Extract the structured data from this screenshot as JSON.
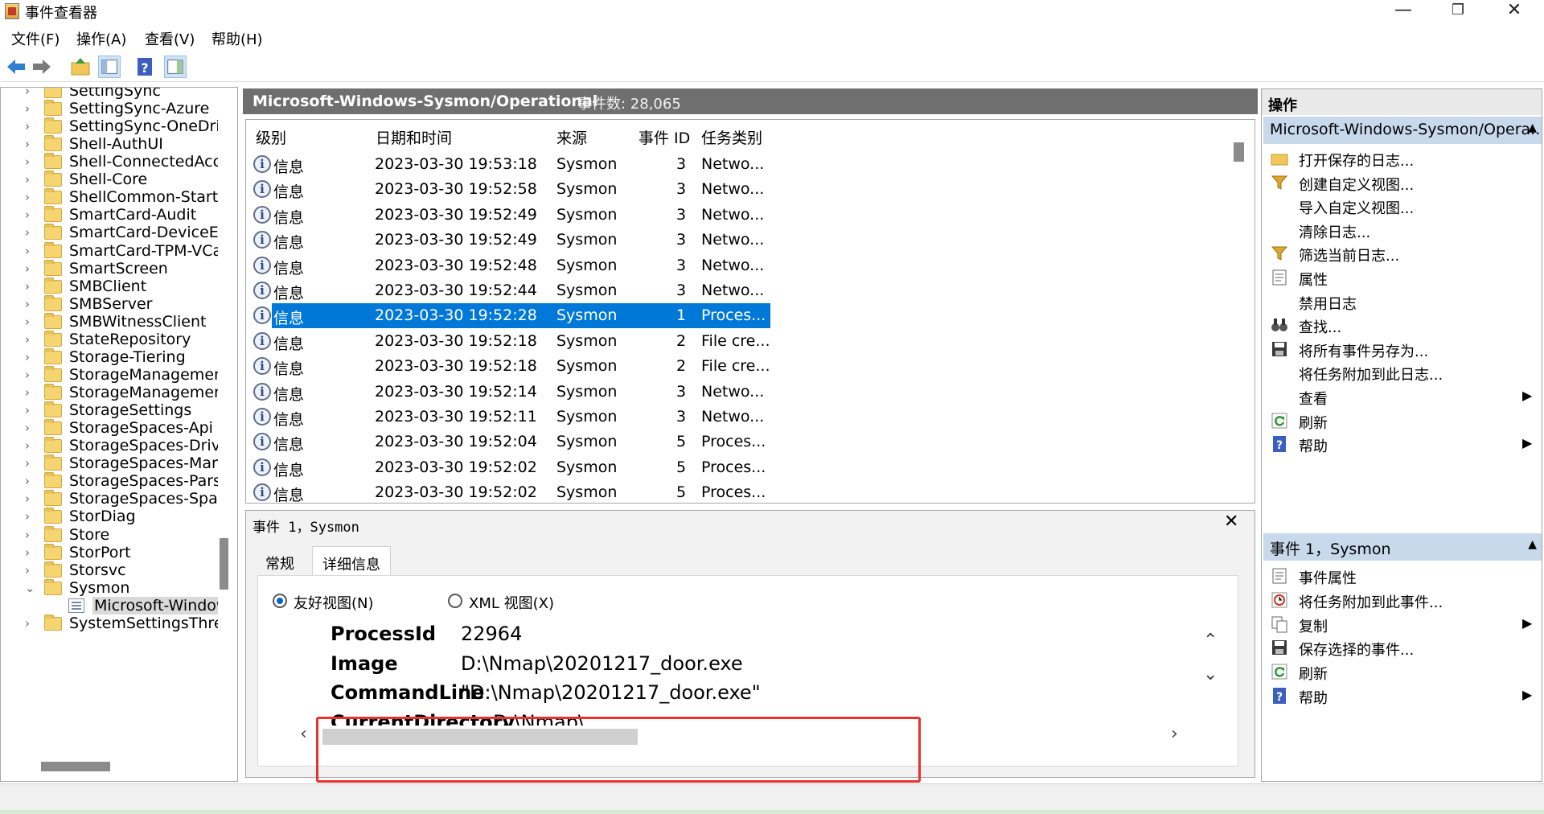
{
  "window": {
    "title": "事件查看器"
  },
  "menu": [
    "文件(F)",
    "操作(A)",
    "查看(V)",
    "帮助(H)"
  ],
  "tree": {
    "items": [
      "SettingSync",
      "SettingSync-Azure",
      "SettingSync-OneDrive",
      "Shell-AuthUI",
      "Shell-ConnectedAccou",
      "Shell-Core",
      "ShellCommon-StartLa",
      "SmartCard-Audit",
      "SmartCard-DeviceEnu",
      "SmartCard-TPM-VCard",
      "SmartScreen",
      "SMBClient",
      "SMBServer",
      "SMBWitnessClient",
      "StateRepository",
      "Storage-Tiering",
      "StorageManagement",
      "StorageManagement-",
      "StorageSettings",
      "StorageSpaces-Api",
      "StorageSpaces-Driver",
      "StorageSpaces-Manag",
      "StorageSpaces-Parser",
      "StorageSpaces-SpaceI",
      "StorDiag",
      "Store",
      "StorPort",
      "Storsvc",
      "Sysmon"
    ],
    "selected": "Microsoft-Window",
    "after": "SystemSettingsThresh"
  },
  "log": {
    "name": "Microsoft-Windows-Sysmon/Operational",
    "count": "事件数: 28,065"
  },
  "columns": [
    "级别",
    "日期和时间",
    "来源",
    "事件 ID",
    "任务类别"
  ],
  "events": [
    {
      "level": "信息",
      "time": "2023-03-30 19:53:18",
      "source": "Sysmon",
      "id": "3",
      "task": "Netwo..."
    },
    {
      "level": "信息",
      "time": "2023-03-30 19:52:58",
      "source": "Sysmon",
      "id": "3",
      "task": "Netwo..."
    },
    {
      "level": "信息",
      "time": "2023-03-30 19:52:49",
      "source": "Sysmon",
      "id": "3",
      "task": "Netwo..."
    },
    {
      "level": "信息",
      "time": "2023-03-30 19:52:49",
      "source": "Sysmon",
      "id": "3",
      "task": "Netwo..."
    },
    {
      "level": "信息",
      "time": "2023-03-30 19:52:48",
      "source": "Sysmon",
      "id": "3",
      "task": "Netwo..."
    },
    {
      "level": "信息",
      "time": "2023-03-30 19:52:44",
      "source": "Sysmon",
      "id": "3",
      "task": "Netwo..."
    },
    {
      "level": "信息",
      "time": "2023-03-30 19:52:28",
      "source": "Sysmon",
      "id": "1",
      "task": "Proces...",
      "selected": true
    },
    {
      "level": "信息",
      "time": "2023-03-30 19:52:18",
      "source": "Sysmon",
      "id": "2",
      "task": "File cre..."
    },
    {
      "level": "信息",
      "time": "2023-03-30 19:52:18",
      "source": "Sysmon",
      "id": "2",
      "task": "File cre..."
    },
    {
      "level": "信息",
      "time": "2023-03-30 19:52:14",
      "source": "Sysmon",
      "id": "3",
      "task": "Netwo..."
    },
    {
      "level": "信息",
      "time": "2023-03-30 19:52:11",
      "source": "Sysmon",
      "id": "3",
      "task": "Netwo..."
    },
    {
      "level": "信息",
      "time": "2023-03-30 19:52:04",
      "source": "Sysmon",
      "id": "5",
      "task": "Proces..."
    },
    {
      "level": "信息",
      "time": "2023-03-30 19:52:02",
      "source": "Sysmon",
      "id": "5",
      "task": "Proces..."
    },
    {
      "level": "信息",
      "time": "2023-03-30 19:52:02",
      "source": "Sysmon",
      "id": "5",
      "task": "Proces..."
    }
  ],
  "details": {
    "title": "事件 1，Sysmon",
    "tabs": [
      "常规",
      "详细信息"
    ],
    "friendly": "友好视图(N)",
    "xml": "XML 视图(X)",
    "fields": [
      {
        "key": "ProcessId",
        "value": "22964"
      },
      {
        "key": "Image",
        "value": "D:\\Nmap\\20201217_door.exe"
      },
      {
        "key": "CommandLine",
        "value": "\"D:\\Nmap\\20201217_door.exe\""
      },
      {
        "key": "CurrentDirectory",
        "value": "D:\\Nmap\\"
      }
    ]
  },
  "actions": {
    "header": "操作",
    "section1": "Microsoft-Windows-Sysmon/Opera...",
    "items1": [
      {
        "label": "打开保存的日志...",
        "icon": "folder-open-icon"
      },
      {
        "label": "创建自定义视图...",
        "icon": "filter-icon"
      },
      {
        "label": "导入自定义视图..."
      },
      {
        "label": "清除日志..."
      },
      {
        "label": "筛选当前日志...",
        "icon": "filter-icon"
      },
      {
        "label": "属性",
        "icon": "properties-icon"
      },
      {
        "label": "禁用日志"
      },
      {
        "label": "查找...",
        "icon": "binoculars-icon"
      },
      {
        "label": "将所有事件另存为...",
        "icon": "save-icon"
      },
      {
        "label": "将任务附加到此日志..."
      },
      {
        "label": "查看",
        "submenu": true
      },
      {
        "label": "刷新",
        "icon": "refresh-icon"
      },
      {
        "label": "帮助",
        "icon": "help-icon",
        "submenu": true
      }
    ],
    "section2": "事件 1，Sysmon",
    "items2": [
      {
        "label": "事件属性",
        "icon": "properties-icon"
      },
      {
        "label": "将任务附加到此事件...",
        "icon": "task-icon"
      },
      {
        "label": "复制",
        "icon": "copy-icon",
        "submenu": true
      },
      {
        "label": "保存选择的事件...",
        "icon": "save-icon"
      },
      {
        "label": "刷新",
        "icon": "refresh-icon"
      },
      {
        "label": "帮助",
        "icon": "help-icon",
        "submenu": true
      }
    ]
  },
  "colors": {
    "selection": "#0078d7",
    "header": "#6f6f6f",
    "section": "#c9d9ec",
    "highlight": "#e8322d"
  }
}
